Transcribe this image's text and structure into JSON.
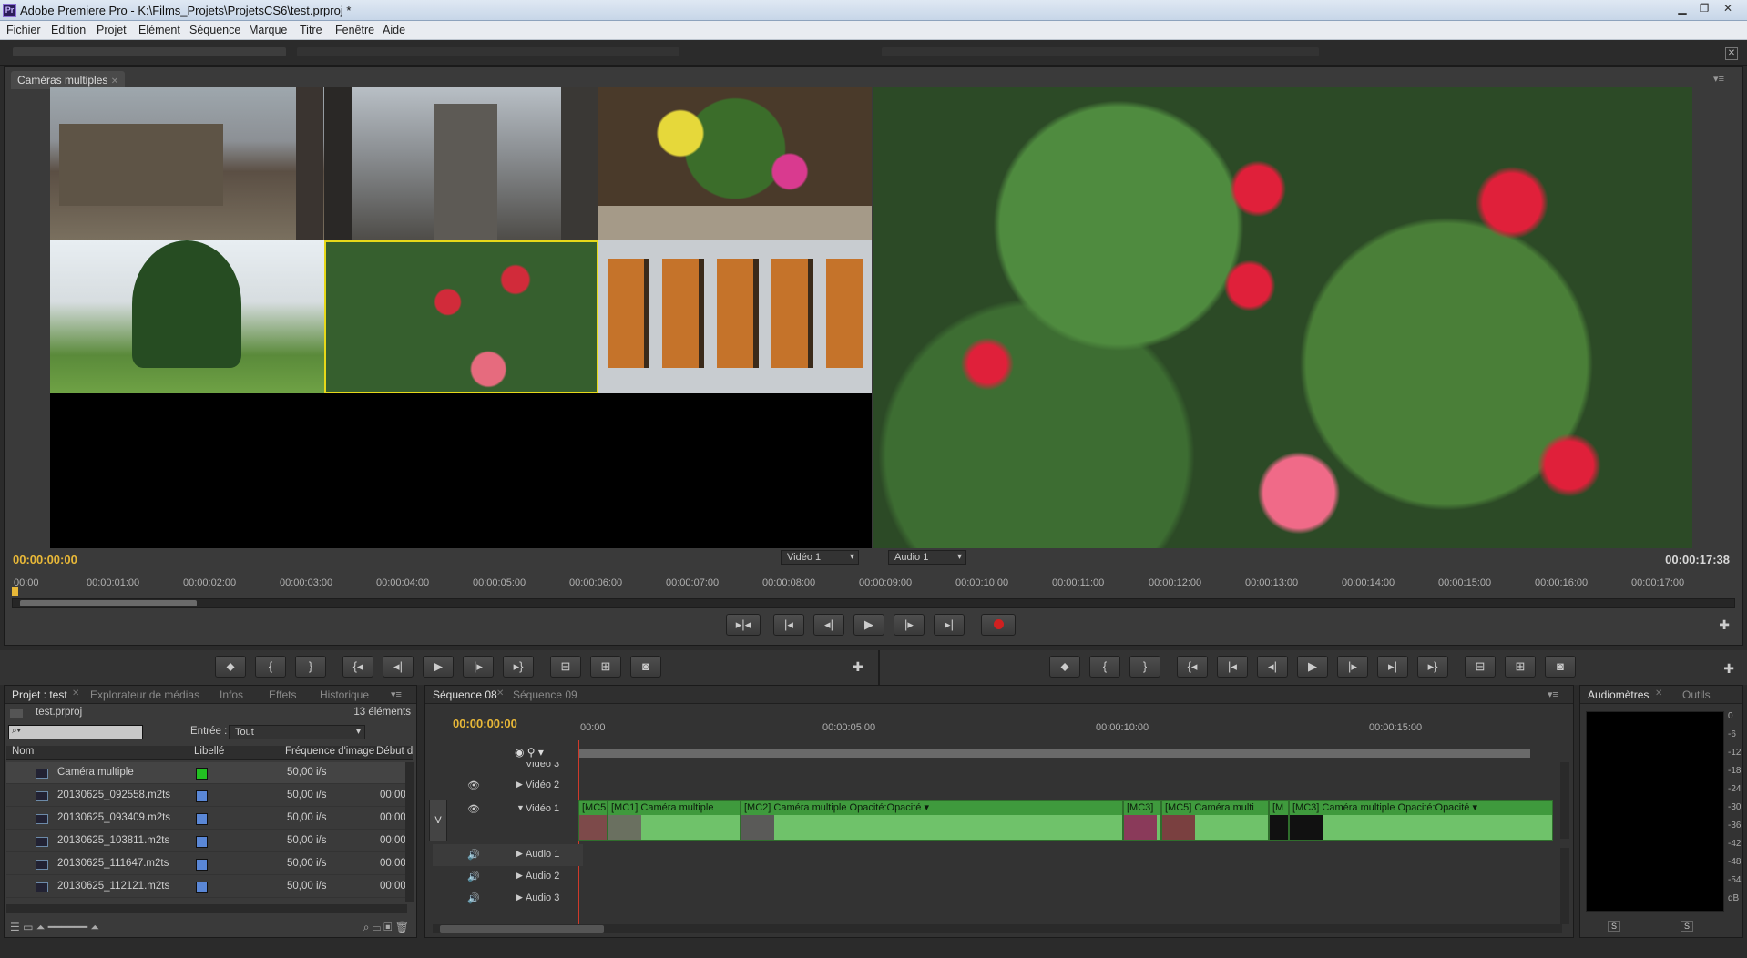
{
  "window": {
    "title": "Adobe Premiere Pro - K:\\Films_Projets\\ProjetsCS6\\test.prproj *",
    "app_icon": "Pr"
  },
  "menu": [
    "Fichier",
    "Edition",
    "Projet",
    "Elément",
    "Séquence",
    "Marque",
    "Titre",
    "Fenêtre",
    "Aide"
  ],
  "multicam": {
    "tab_label": "Caméras multiples",
    "timecode_start": "00:00:00:00",
    "timecode_end": "00:00:17:38",
    "video_select": "Vidéo 1",
    "audio_select": "Audio 1",
    "ruler": [
      "00:00",
      "00:00:01:00",
      "00:00:02:00",
      "00:00:03:00",
      "00:00:04:00",
      "00:00:05:00",
      "00:00:06:00",
      "00:00:07:00",
      "00:00:08:00",
      "00:00:09:00",
      "00:00:10:00",
      "00:00:11:00",
      "00:00:12:00",
      "00:00:13:00",
      "00:00:14:00",
      "00:00:15:00",
      "00:00:16:00",
      "00:00:17:00"
    ],
    "record_color": "#d02020",
    "active_camera_color": "#e6d81a"
  },
  "project": {
    "tabs": [
      "Projet : test",
      "Explorateur de médias",
      "Infos",
      "Effets",
      "Historique"
    ],
    "file": "test.prproj",
    "count": "13 éléments",
    "entree_label": "Entrée :",
    "entree_value": "Tout",
    "columns": [
      "Nom",
      "Libellé",
      "Fréquence d'image",
      "Début d"
    ],
    "items": [
      {
        "name": "Caméra multiple",
        "label_color": "#22c022",
        "rate": "50,00 i/s",
        "start": ""
      },
      {
        "name": "20130625_092558.m2ts",
        "label_color": "#5a87d6",
        "rate": "50,00 i/s",
        "start": "00:00"
      },
      {
        "name": "20130625_093409.m2ts",
        "label_color": "#5a87d6",
        "rate": "50,00 i/s",
        "start": "00:00"
      },
      {
        "name": "20130625_103811.m2ts",
        "label_color": "#5a87d6",
        "rate": "50,00 i/s",
        "start": "00:00"
      },
      {
        "name": "20130625_111647.m2ts",
        "label_color": "#5a87d6",
        "rate": "50,00 i/s",
        "start": "00:00"
      },
      {
        "name": "20130625_112121.m2ts",
        "label_color": "#5a87d6",
        "rate": "50,00 i/s",
        "start": "00:00"
      }
    ]
  },
  "timeline": {
    "tabs": [
      "Séquence 08",
      "Séquence 09"
    ],
    "timecode": "00:00:00:00",
    "ruler": [
      "00:00",
      "00:00:05:00",
      "00:00:10:00",
      "00:00:15:00"
    ],
    "v_label": "V",
    "tracks": {
      "video3": "Vidéo 3",
      "video2": "Vidéo 2",
      "video1": "Vidéo 1",
      "audio1": "Audio 1",
      "audio2": "Audio 2",
      "audio3": "Audio 3"
    },
    "clips": [
      {
        "label": "[MC5"
      },
      {
        "label": "[MC1]  Caméra multiple"
      },
      {
        "label": "[MC2]  Caméra multiple",
        "fx": "Opacité:Opacité ▾"
      },
      {
        "label": "[MC3]"
      },
      {
        "label": "[MC5]  Caméra multi"
      },
      {
        "label": "[M"
      },
      {
        "label": "[MC3]  Caméra multiple",
        "fx": "Opacité:Opacité ▾"
      }
    ]
  },
  "audio": {
    "tabs": [
      "Audiomètres",
      "Outils"
    ],
    "scale": [
      "0",
      "-6",
      "-12",
      "-18",
      "-24",
      "-30",
      "-36",
      "-42",
      "-48",
      "-54",
      "dB"
    ],
    "solo": "S"
  }
}
